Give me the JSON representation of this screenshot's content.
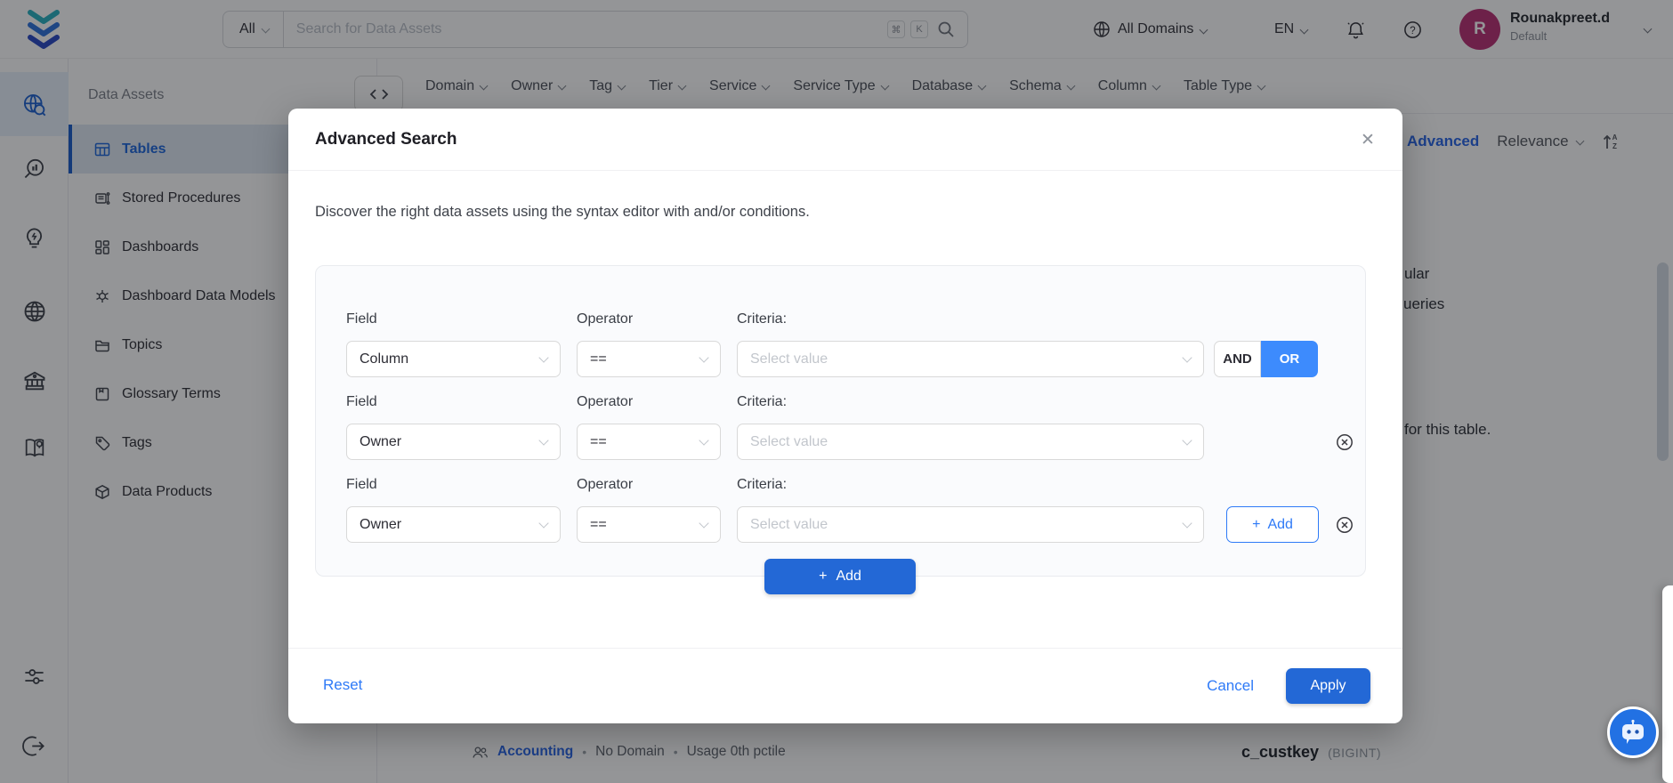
{
  "header": {
    "search_scope": "All",
    "search_placeholder": "Search for Data Assets",
    "kbd_cmd": "⌘",
    "kbd_k": "K",
    "domains_label": "All Domains",
    "language_label": "EN",
    "user_initial": "R",
    "user_name": "Rounakpreet.d",
    "user_role": "Default"
  },
  "sidebar": {
    "title": "Data Assets",
    "items": [
      {
        "label": "Tables"
      },
      {
        "label": "Stored Procedures"
      },
      {
        "label": "Dashboards"
      },
      {
        "label": "Dashboard Data Models"
      },
      {
        "label": "Topics"
      },
      {
        "label": "Glossary Terms"
      },
      {
        "label": "Tags"
      },
      {
        "label": "Data Products"
      }
    ]
  },
  "filter_bar": {
    "filters": [
      "Domain",
      "Owner",
      "Tag",
      "Tier",
      "Service",
      "Service Type",
      "Database",
      "Schema",
      "Column",
      "Table Type"
    ],
    "advanced_label": "Advanced",
    "sort_label": "Relevance"
  },
  "content": {
    "clip_1": "ular",
    "clip_2": "ueries",
    "clip_3": "for this table.",
    "owner_link": "Accounting",
    "bullet": "•",
    "domain_status": "No Domain",
    "usage_status": "Usage 0th pctile",
    "column_name": "c_custkey",
    "column_type": "(BIGINT)"
  },
  "modal": {
    "title": "Advanced Search",
    "close_glyph": "✕",
    "description": "Discover the right data assets using the syntax editor with and/or conditions.",
    "labels": {
      "field": "Field",
      "operator": "Operator",
      "criteria": "Criteria:"
    },
    "rows": [
      {
        "field": "Column",
        "operator": "==",
        "criteria_placeholder": "Select value"
      },
      {
        "field": "Owner",
        "operator": "==",
        "criteria_placeholder": "Select value"
      },
      {
        "field": "Owner",
        "operator": "==",
        "criteria_placeholder": "Select value"
      }
    ],
    "and_label": "AND",
    "or_label": "OR",
    "add_plus": "+",
    "add_label": "Add",
    "reset_label": "Reset",
    "cancel_label": "Cancel",
    "apply_label": "Apply"
  },
  "glyphs": {
    "sort_a": "A",
    "sort_z": "Z",
    "question": "?"
  },
  "colors": {
    "primary": "#2368d6",
    "or_active": "#3d8bfd",
    "link": "#2e7af7",
    "avatar": "#b92d72",
    "active_item": "#1b64da"
  }
}
